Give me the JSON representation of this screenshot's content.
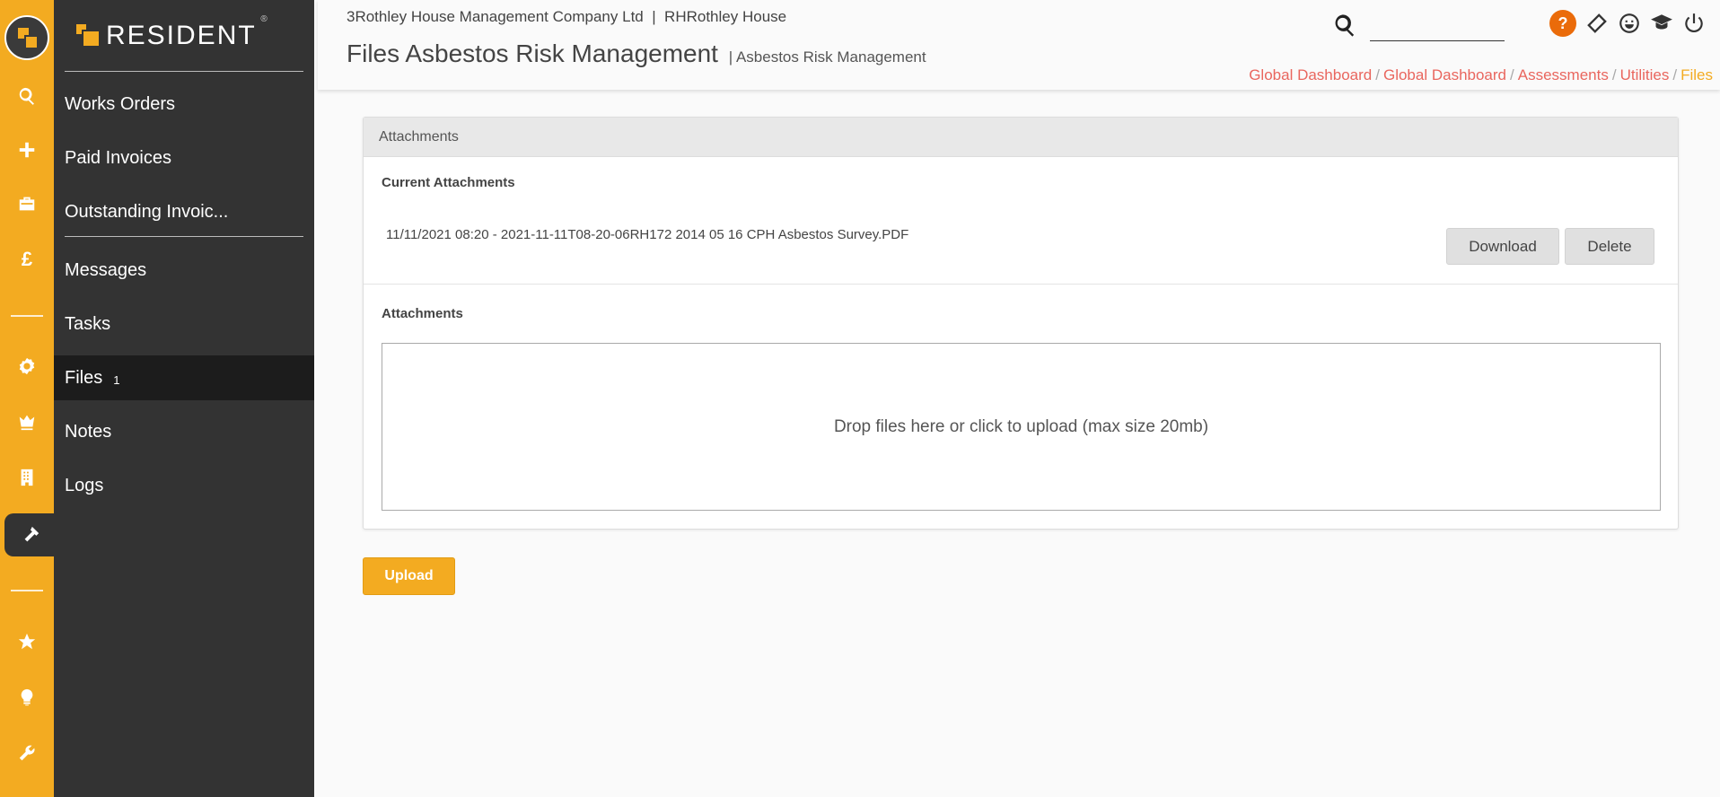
{
  "brand": {
    "name": "RESIDENT",
    "reg": "®"
  },
  "sidebar": {
    "items": [
      {
        "label": "Works Orders"
      },
      {
        "label": "Paid Invoices"
      },
      {
        "label": "Outstanding Invoic..."
      },
      {
        "label": "Messages"
      },
      {
        "label": "Tasks"
      },
      {
        "label": "Files",
        "count": "1"
      },
      {
        "label": "Notes"
      },
      {
        "label": "Logs"
      }
    ]
  },
  "header": {
    "company": "3Rothley House Management Company Ltd  |  RHRothley House",
    "title": "Files Asbestos Risk Management",
    "subtitle": "| Asbestos Risk Management",
    "help": "?",
    "search_placeholder": ""
  },
  "breadcrumbs": [
    "Global Dashboard",
    "Global Dashboard",
    "Assessments",
    "Utilities",
    "Files"
  ],
  "panel": {
    "heading": "Attachments",
    "current_label": "Current Attachments",
    "file": "11/11/2021 08:20 - 2021-11-11T08-20-06RH172 2014 05 16 CPH Asbestos Survey.PDF",
    "download_label": "Download",
    "delete_label": "Delete",
    "attachments_label": "Attachments",
    "dropzone_text": "Drop files here or click to upload (max size 20mb)"
  },
  "upload_label": "Upload",
  "colors": {
    "accent": "#f3ab21",
    "sidebar": "#333333",
    "breadcrumb": "#e9665e",
    "help": "#ea6b0a"
  }
}
